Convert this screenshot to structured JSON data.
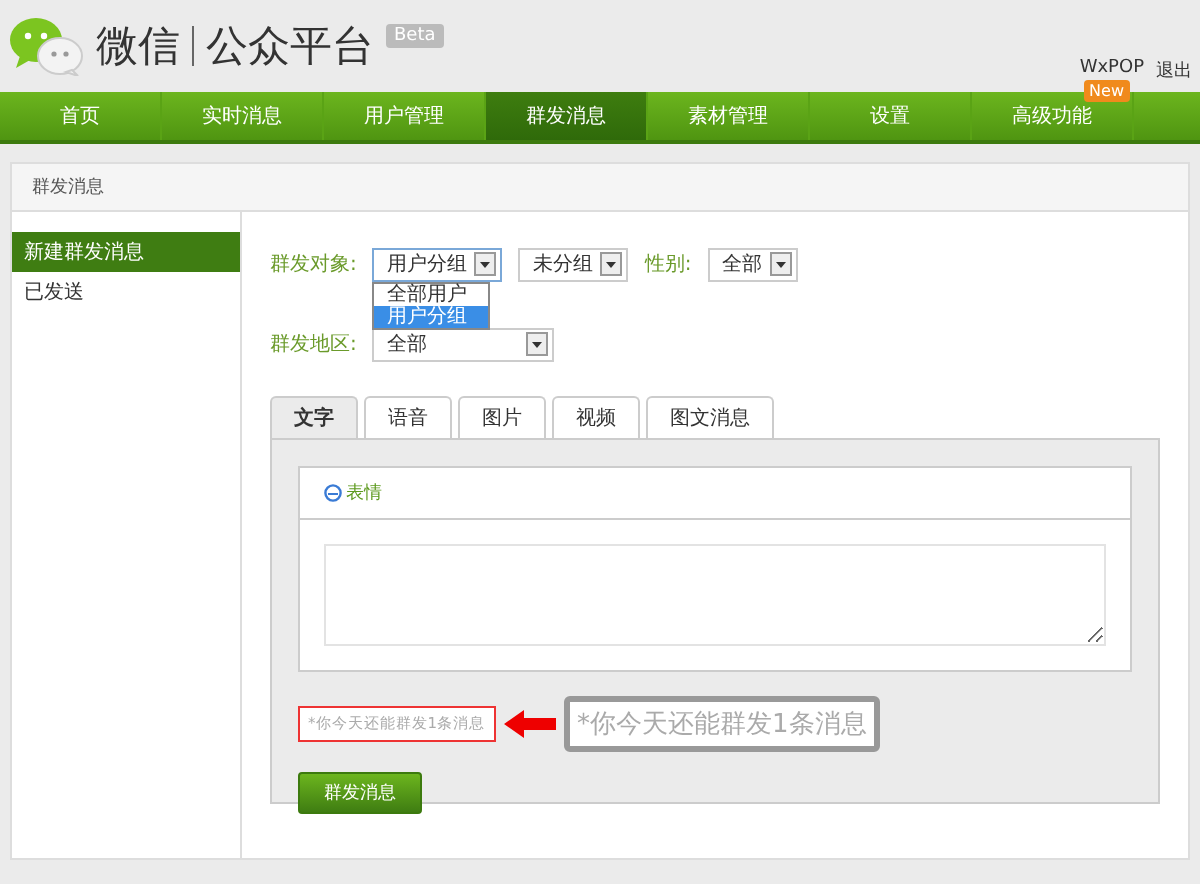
{
  "header": {
    "brand": "微信",
    "product": "公众平台",
    "badge": "Beta",
    "user": "WxPOP",
    "logout": "退出"
  },
  "nav": [
    {
      "label": "首页",
      "selected": false
    },
    {
      "label": "实时消息",
      "selected": false
    },
    {
      "label": "用户管理",
      "selected": false
    },
    {
      "label": "群发消息",
      "selected": true
    },
    {
      "label": "素材管理",
      "selected": false
    },
    {
      "label": "设置",
      "selected": false
    },
    {
      "label": "高级功能",
      "selected": false,
      "badge": "New"
    }
  ],
  "breadcrumb": "群发消息",
  "sidebar": [
    {
      "label": "新建群发消息",
      "selected": true
    },
    {
      "label": "已发送",
      "selected": false
    }
  ],
  "target": {
    "label": "群发对象:",
    "value": "用户分组",
    "group": "未分组",
    "gender_label": "性别:",
    "gender": "全部",
    "options": [
      {
        "label": "全部用户",
        "selected": false
      },
      {
        "label": "用户分组",
        "selected": true
      }
    ]
  },
  "region": {
    "label": "群发地区:",
    "value": "全部"
  },
  "tabs": [
    {
      "label": "文字",
      "selected": true
    },
    {
      "label": "语音",
      "selected": false
    },
    {
      "label": "图片",
      "selected": false
    },
    {
      "label": "视频",
      "selected": false
    },
    {
      "label": "图文消息",
      "selected": false
    }
  ],
  "editor": {
    "emoji": "表情"
  },
  "notice": "*你今天还能群发1条消息",
  "callout": "*你今天还能群发1条消息",
  "send_button": "群发消息"
}
